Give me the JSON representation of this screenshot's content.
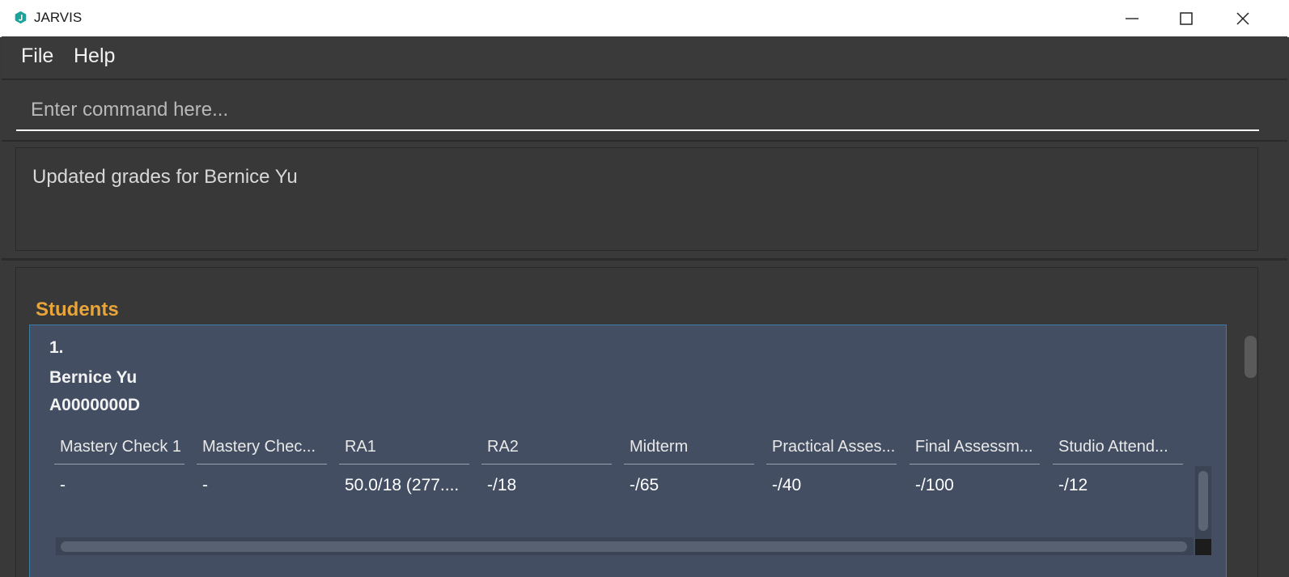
{
  "window": {
    "title": "JARVIS",
    "minimize_glyph": "─",
    "maximize_glyph": "☐",
    "close_glyph": "✕"
  },
  "menu": {
    "items": [
      {
        "label": "File"
      },
      {
        "label": "Help"
      }
    ]
  },
  "command": {
    "placeholder": "Enter command here...",
    "value": ""
  },
  "result": {
    "message": "Updated grades for Bernice Yu"
  },
  "students": {
    "title": "Students",
    "list": [
      {
        "index": "1.",
        "name": "Bernice Yu",
        "matric": "A0000000D",
        "grades": {
          "headers": [
            "Mastery Check 1",
            "Mastery Chec...",
            "RA1",
            "RA2",
            "Midterm",
            "Practical Asses...",
            "Final Assessm...",
            "Studio Attend..."
          ],
          "values": [
            "-",
            "-",
            "50.0/18 (277....",
            "-/18",
            "-/65",
            "-/40",
            "-/100",
            "-/12"
          ]
        }
      }
    ]
  },
  "colors": {
    "accent": "#e8a53a",
    "card_background": "#434e62",
    "card_border": "#3d7ea6",
    "app_background": "#393939",
    "icon_teal": "#1aa39a"
  },
  "icons": {
    "app": "jarvis-app-icon",
    "minimize": "minimize-icon",
    "maximize": "maximize-icon",
    "close": "close-icon"
  }
}
